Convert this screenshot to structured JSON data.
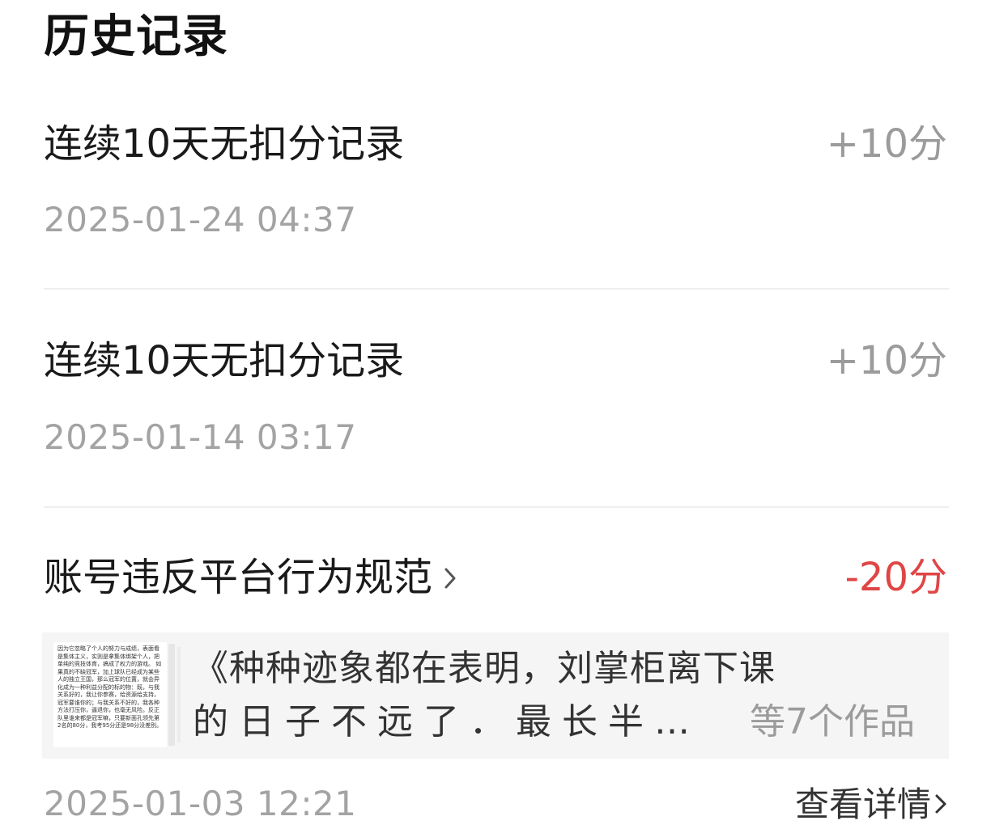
{
  "page": {
    "title": "历史记录"
  },
  "records": [
    {
      "title": "连续10天无扣分记录",
      "points": "+10分",
      "time": "2025-01-24 04:37"
    },
    {
      "title": "连续10天无扣分记录",
      "points": "+10分",
      "time": "2025-01-14 03:17"
    },
    {
      "title": "账号违反平台行为规范",
      "points": "-20分",
      "time": "2025-01-03 12:21",
      "works": {
        "thumbnail_text": "因为它忽略了个人的努力与成绩，表面看是集体主义，实则是拿集体绑架个人，把单纯的竞技体育，搞成了权力的游戏。 如果真的不缺冠军，加上球队已经成为某些人的独立王国，那么冠军的位置，就会异化成为一种利益分配的标的物：既，与我关系好的，我让你参赛，给资源给支持，冠军要谁你的；与我关系不好的，我各种方法打压你，逼退你，也毫无风险。反正队里谁来都是冠军嘛，只要新面孔领先第2名的80分，我考95分还是98分没差别。",
        "line1": "《种种迹象都在表明，刘掌柜离下课",
        "line2": "的日子不远了．最长半",
        "ellipsis": "…",
        "count_label": "等7个作品"
      },
      "details_label": "查看详情"
    }
  ],
  "colors": {
    "positive_points": "#9b9b9b",
    "negative_points": "#e04545",
    "timestamp": "#a3a3a3"
  }
}
